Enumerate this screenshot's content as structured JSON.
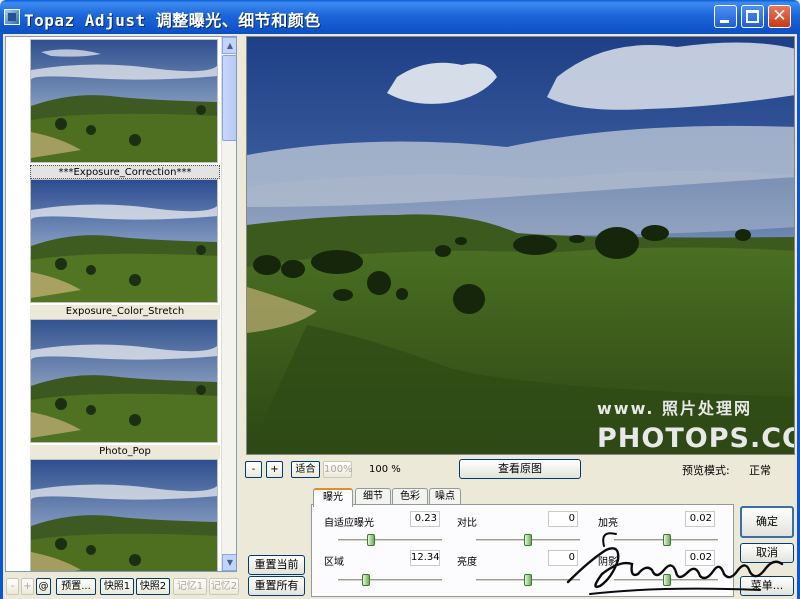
{
  "window": {
    "title": "Topaz Adjust 调整曝光、细节和颜色",
    "controls": [
      "minimize",
      "maximize",
      "close"
    ]
  },
  "presets": {
    "items": [
      {
        "label": "***Exposure_Correction***",
        "selected": true
      },
      {
        "label": "Exposure_Color_Stretch",
        "selected": false
      },
      {
        "label": "Photo_Pop",
        "selected": false
      },
      {
        "label": "",
        "selected": false
      }
    ]
  },
  "preview": {
    "watermark_line1": "www. 照片处理网",
    "watermark_line2": "PHOTOPS.COM"
  },
  "zoom": {
    "minus_label": "-",
    "plus_label": "+",
    "fit_label": "适合",
    "percent_button_label": "100%",
    "zoom_value": "100 %",
    "view_original_label": "查看原图"
  },
  "preview_mode": {
    "label": "预览模式:",
    "value": "正常"
  },
  "tabs": [
    {
      "label": "曝光",
      "active": true
    },
    {
      "label": "细节",
      "active": false
    },
    {
      "label": "色彩",
      "active": false
    },
    {
      "label": "噪点",
      "active": false
    }
  ],
  "params": [
    {
      "label": "自适应曝光",
      "value": "0.23",
      "level": 0.3
    },
    {
      "label": "对比",
      "value": "0",
      "level": 0.5
    },
    {
      "label": "加亮",
      "value": "0.02",
      "level": 0.51
    },
    {
      "label": "区域",
      "value": "12.34",
      "level": 0.25
    },
    {
      "label": "亮度",
      "value": "0",
      "level": 0.5
    },
    {
      "label": "阴影",
      "value": "0.02",
      "level": 0.51
    }
  ],
  "actions": {
    "reset_current": "重置当前",
    "reset_all": "重置所有",
    "ok": "确定",
    "cancel": "取消",
    "menu": "菜单..."
  },
  "bottom_bar": {
    "minus": "-",
    "plus": "+",
    "at": "@",
    "presets": "预置...",
    "snapshot1": "快照1",
    "snapshot2": "快照2",
    "memory1": "记忆1",
    "memory2": "记忆2"
  },
  "colors": {
    "title_bar": "#1c66d8",
    "tab_accent": "#e68b2c",
    "slider_thumb": "#6cb05a"
  }
}
